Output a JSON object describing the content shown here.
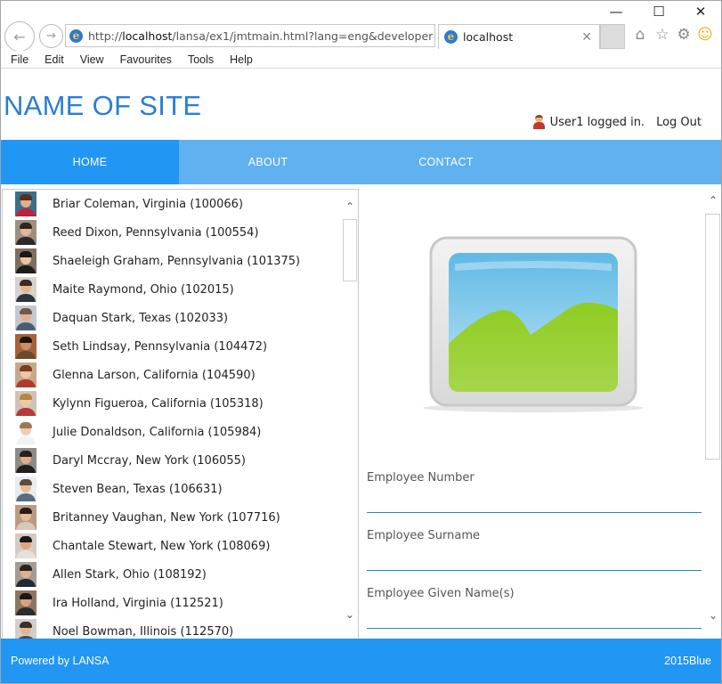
{
  "browser": {
    "url_prefix": "http://",
    "url_host": "localhost",
    "url_rest": "/lansa/ex1/jmtmain.html?lang=eng&developer=",
    "tab_title": "localhost",
    "menu": [
      "File",
      "Edit",
      "View",
      "Favourites",
      "Tools",
      "Help"
    ],
    "win_controls": {
      "minimize": "—",
      "maximize": "☐",
      "close": "✕"
    }
  },
  "header": {
    "site_title": "NAME OF SITE",
    "user_status": "User1 logged in.",
    "logout": "Log Out"
  },
  "nav": {
    "items": [
      {
        "label": "HOME",
        "active": true
      },
      {
        "label": "ABOUT",
        "active": false
      },
      {
        "label": "CONTACT",
        "active": false
      }
    ]
  },
  "employees": [
    {
      "label": "Briar Coleman, Virginia (100066)",
      "skin": "#e0b089",
      "hair": "#5a2d1c",
      "shirt": "#b9253a",
      "bg": "#3c6e8a"
    },
    {
      "label": "Reed Dixon, Pennsylvania (100554)",
      "skin": "#e3b695",
      "hair": "#2f2620",
      "shirt": "#2a2a2a",
      "bg": "#9e8f7e"
    },
    {
      "label": "Shaeleigh Graham, Pennsylvania (101375)",
      "skin": "#edc3a2",
      "hair": "#1e1612",
      "shirt": "#1c1c1c",
      "bg": "#7e6f60"
    },
    {
      "label": "Maite Raymond, Ohio (102015)",
      "skin": "#e6b58f",
      "hair": "#3c2b22",
      "shirt": "#2b3440",
      "bg": "#d9d3cb"
    },
    {
      "label": "Daquan Stark, Texas (102033)",
      "skin": "#e1b190",
      "hair": "#6a5b4e",
      "shirt": "#4c5c73",
      "bg": "#c5c9cf"
    },
    {
      "label": "Seth Lindsay, Pennsylvania (104472)",
      "skin": "#c8906a",
      "hair": "#1d1411",
      "shirt": "#6b4b2a",
      "bg": "#a7623a"
    },
    {
      "label": "Glenna Larson, California (104590)",
      "skin": "#efc5a4",
      "hair": "#7a3e22",
      "shirt": "#b03a2e",
      "bg": "#c6a88b"
    },
    {
      "label": "Kylynn Figueroa, California (105318)",
      "skin": "#efc8a8",
      "hair": "#b9863e",
      "shirt": "#b33b3b",
      "bg": "#d1c3b4"
    },
    {
      "label": "Julie Donaldson, California (105984)",
      "skin": "#efcdb2",
      "hair": "#9a7a55",
      "shirt": "#f2f2f2",
      "bg": "#ffffff"
    },
    {
      "label": "Daryl Mccray, New York (106055)",
      "skin": "#e0ad8a",
      "hair": "#27201c",
      "shirt": "#1f1f1f",
      "bg": "#8f8b86"
    },
    {
      "label": "Steven Bean, Texas (106631)",
      "skin": "#e6bb98",
      "hair": "#5c4a3a",
      "shirt": "#5b6b7e",
      "bg": "#e9ecef"
    },
    {
      "label": "Britanney Vaughan, New York (107716)",
      "skin": "#e9bc98",
      "hair": "#2a1d17",
      "shirt": "#d8c8bc",
      "bg": "#b99a82"
    },
    {
      "label": "Chantale Stewart, New York (108069)",
      "skin": "#dba683",
      "hair": "#1f1713",
      "shirt": "#e6e1dc",
      "bg": "#d4ccc3"
    },
    {
      "label": "Allen Stark, Ohio (108192)",
      "skin": "#e2b08d",
      "hair": "#2b231e",
      "shirt": "#1e2a36",
      "bg": "#a59c92"
    },
    {
      "label": "Ira Holland, Virginia (112521)",
      "skin": "#d9a27c",
      "hair": "#1d1613",
      "shirt": "#2c2c2c",
      "bg": "#8e7563"
    },
    {
      "label": "Noel Bowman, Illinois (112570)",
      "skin": "#e2b695",
      "hair": "#3b2e27",
      "shirt": "#4a4a4a",
      "bg": "#d2cfcb"
    }
  ],
  "detail": {
    "fields": [
      {
        "label": "Employee Number",
        "value": ""
      },
      {
        "label": "Employee Surname",
        "value": ""
      },
      {
        "label": "Employee Given Name(s)",
        "value": ""
      }
    ]
  },
  "footer": {
    "left": "Powered by LANSA",
    "right": "2015Blue"
  }
}
